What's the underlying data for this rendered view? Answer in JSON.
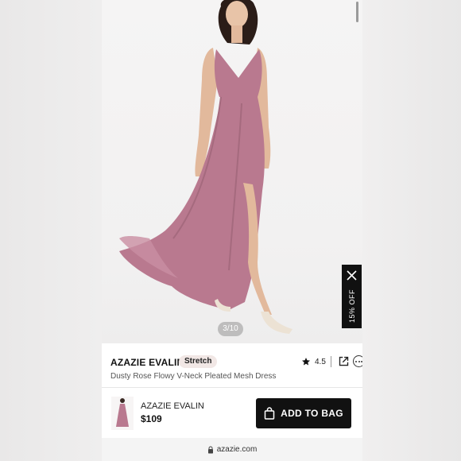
{
  "gallery": {
    "counter": "3/10"
  },
  "promo": {
    "label": "15% OFF"
  },
  "product": {
    "brand": "AZAZIE EVALIN",
    "badge": "Stretch",
    "rating": "4.5",
    "subtitle": "Dusty Rose Flowy V-Neck Pleated Mesh Dress",
    "dress_color": "#b9798f"
  },
  "bag_bar": {
    "name": "AZAZIE EVALIN",
    "price": "$109",
    "button_label": "ADD TO BAG"
  },
  "browser": {
    "url": "azazie.com"
  }
}
